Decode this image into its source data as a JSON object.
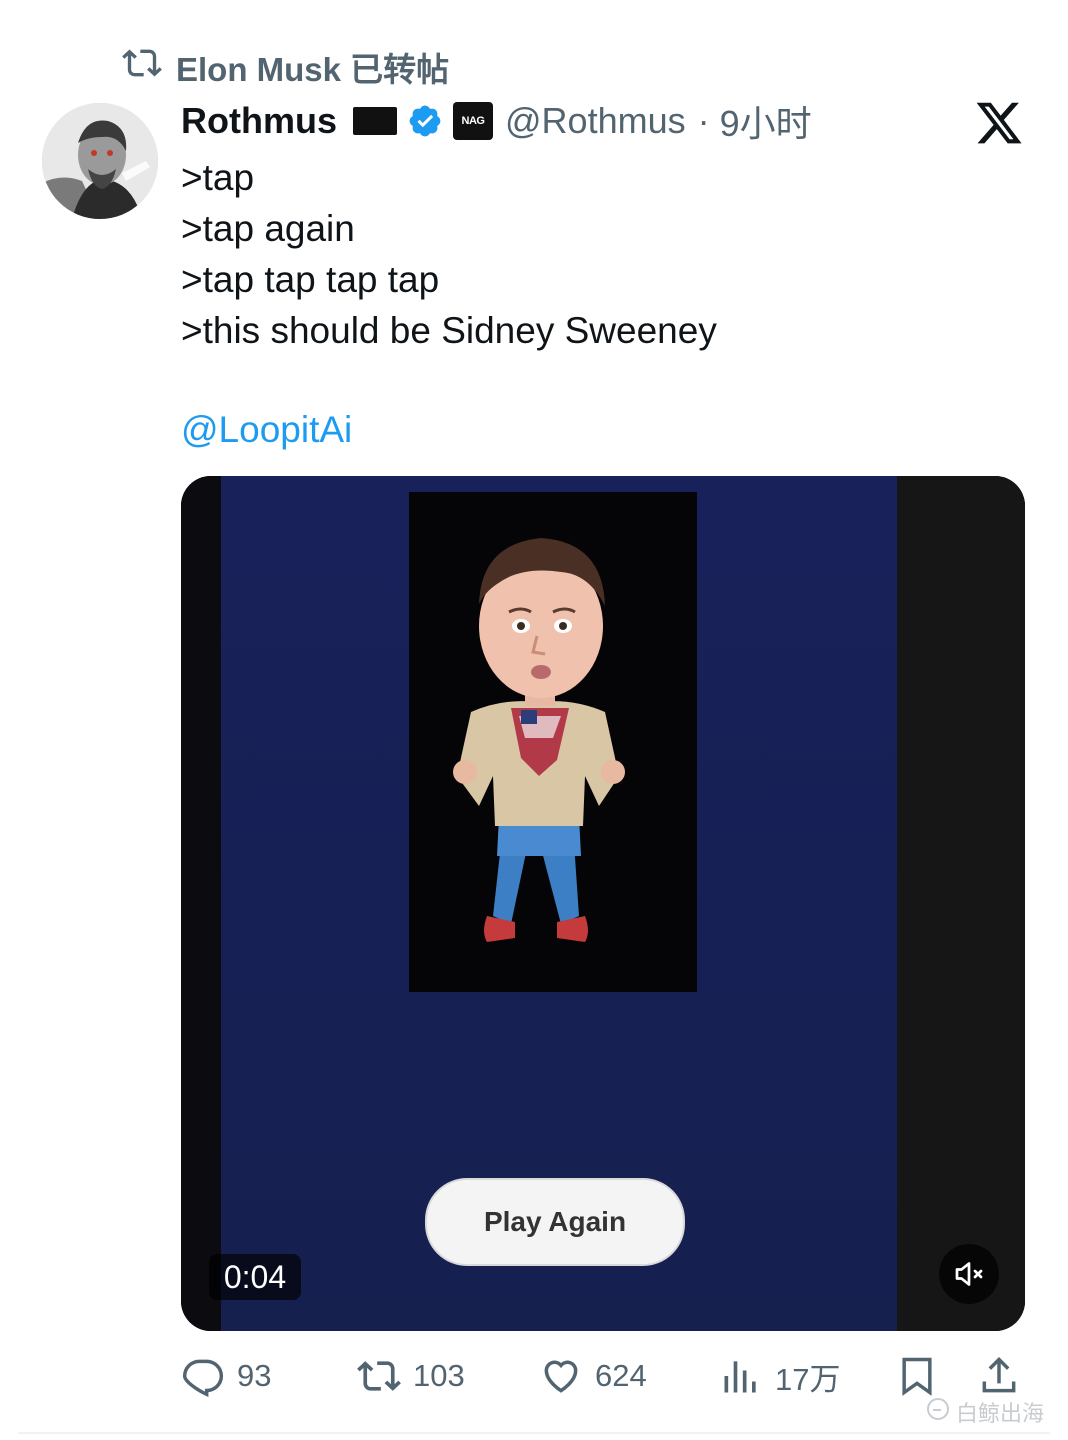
{
  "repost": {
    "text": "Elon Musk 已转帖",
    "icon": "repost-icon"
  },
  "author": {
    "name": "Rothmus",
    "handle": "@Rothmus",
    "time": "9小时",
    "org_badge_text": "NAG",
    "verified_color": "#1d9bf0"
  },
  "post": {
    "lines": [
      ">tap",
      ">tap again",
      ">tap tap tap tap",
      ">this should be Sidney Sweeney"
    ],
    "mention": "@LoopitAi"
  },
  "media": {
    "duration": "0:04",
    "play_again": "Play Again",
    "bg_color": "#1a2358"
  },
  "actions": {
    "replies": "93",
    "reposts": "103",
    "likes": "624",
    "views": "17万"
  },
  "watermark": "白鲸出海"
}
